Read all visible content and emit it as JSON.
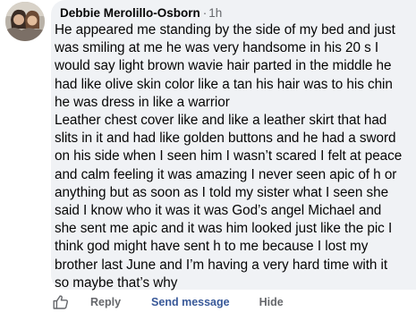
{
  "comment": {
    "author": "Debbie Merolillo-Osborn",
    "separator": "·",
    "time": "1h",
    "text": "He appeared me standing by the side of my bed and just\nwas smiling at me he was very handsome in his 20 s I\nwould say light brown wavie hair parted in the middle he\nhad like olive skin color like a tan his hair was to his chin\nhe was dress in like a warrior\nLeather chest cover like and like a leather skirt that had\nslits in it and had like golden buttons and he had a sword\non his side when I seen him I wasn’t scared I felt at peace\nand calm feeling it was amazing I never seen apic of h or\nanything but as soon as I told my sister what I seen she\nsaid I know who it was it was God’s angel Michael and\nshe sent me apic and it was him looked just like the pic I\nthink god might have sent h to me because I lost my\nbrother last June and I’m having a very hard time with it\nso maybe that’s why"
  },
  "actions": {
    "like_icon": "thumbs-up-icon",
    "reply": "Reply",
    "send_message": "Send message",
    "hide": "Hide"
  },
  "colors": {
    "bubble": "#f0f2f5",
    "text": "#050505",
    "secondary": "#65676b",
    "link": "#385898"
  }
}
